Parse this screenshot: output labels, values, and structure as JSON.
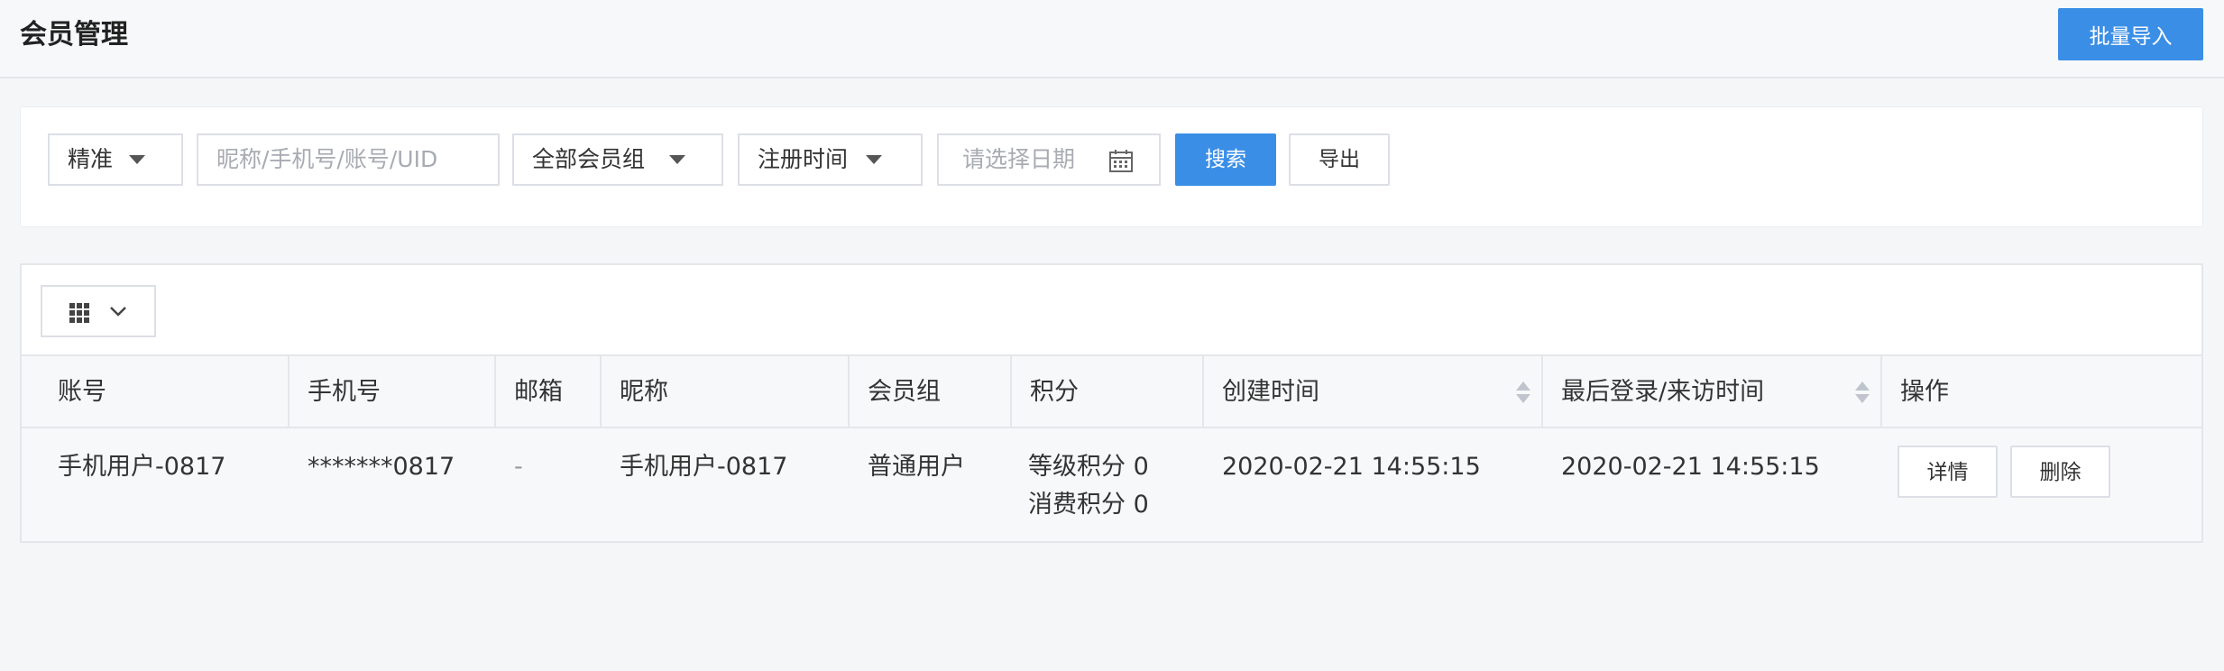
{
  "header": {
    "title": "会员管理",
    "import_label": "批量导入"
  },
  "filters": {
    "match_mode": "精准",
    "search_placeholder": "昵称/手机号/账号/UID",
    "group": "全部会员组",
    "time_field": "注册时间",
    "date_placeholder": "请选择日期",
    "search_label": "搜索",
    "export_label": "导出"
  },
  "table": {
    "columns": [
      "账号",
      "手机号",
      "邮箱",
      "昵称",
      "会员组",
      "积分",
      "创建时间",
      "最后登录/来访时间",
      "操作"
    ],
    "rows": [
      {
        "account": "手机用户-0817",
        "phone": "*******0817",
        "email": "-",
        "nickname": "手机用户-0817",
        "group": "普通用户",
        "points_level": "等级积分 0",
        "points_spend": "消费积分 0",
        "created": "2020-02-21 14:55:15",
        "last_login": "2020-02-21 14:55:15",
        "detail_label": "详情",
        "delete_label": "删除"
      }
    ]
  },
  "colors": {
    "primary": "#3a8ee6",
    "background": "#f5f6f8",
    "border": "#dcdfe6"
  }
}
